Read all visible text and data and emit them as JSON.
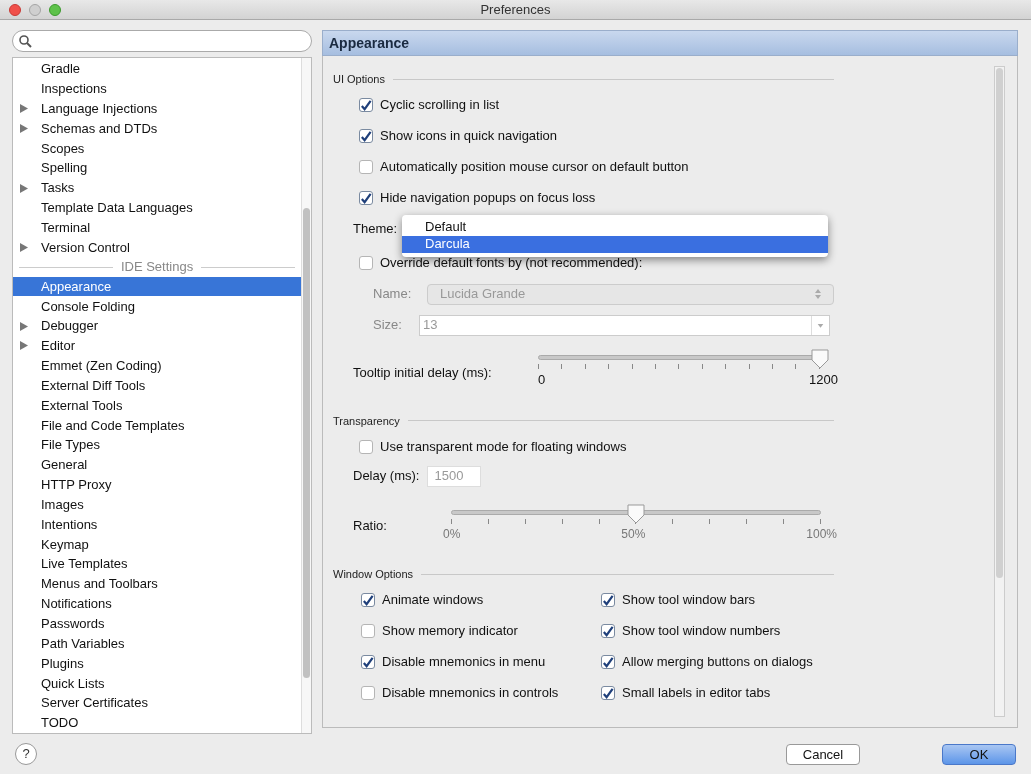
{
  "window": {
    "title": "Preferences"
  },
  "sidebar": {
    "items": [
      {
        "kind": "item",
        "label": "Gradle",
        "expandable": false,
        "selected": false
      },
      {
        "kind": "item",
        "label": "Inspections",
        "expandable": false,
        "selected": false
      },
      {
        "kind": "item",
        "label": "Language Injections",
        "expandable": true,
        "selected": false
      },
      {
        "kind": "item",
        "label": "Schemas and DTDs",
        "expandable": true,
        "selected": false
      },
      {
        "kind": "item",
        "label": "Scopes",
        "expandable": false,
        "selected": false
      },
      {
        "kind": "item",
        "label": "Spelling",
        "expandable": false,
        "selected": false
      },
      {
        "kind": "item",
        "label": "Tasks",
        "expandable": true,
        "selected": false
      },
      {
        "kind": "item",
        "label": "Template Data Languages",
        "expandable": false,
        "selected": false
      },
      {
        "kind": "item",
        "label": "Terminal",
        "expandable": false,
        "selected": false
      },
      {
        "kind": "item",
        "label": "Version Control",
        "expandable": true,
        "selected": false
      },
      {
        "kind": "header",
        "label": "IDE Settings"
      },
      {
        "kind": "item",
        "label": "Appearance",
        "expandable": false,
        "selected": true
      },
      {
        "kind": "item",
        "label": "Console Folding",
        "expandable": false,
        "selected": false
      },
      {
        "kind": "item",
        "label": "Debugger",
        "expandable": true,
        "selected": false
      },
      {
        "kind": "item",
        "label": "Editor",
        "expandable": true,
        "selected": false
      },
      {
        "kind": "item",
        "label": "Emmet (Zen Coding)",
        "expandable": false,
        "selected": false
      },
      {
        "kind": "item",
        "label": "External Diff Tools",
        "expandable": false,
        "selected": false
      },
      {
        "kind": "item",
        "label": "External Tools",
        "expandable": false,
        "selected": false
      },
      {
        "kind": "item",
        "label": "File and Code Templates",
        "expandable": false,
        "selected": false
      },
      {
        "kind": "item",
        "label": "File Types",
        "expandable": false,
        "selected": false
      },
      {
        "kind": "item",
        "label": "General",
        "expandable": false,
        "selected": false
      },
      {
        "kind": "item",
        "label": "HTTP Proxy",
        "expandable": false,
        "selected": false
      },
      {
        "kind": "item",
        "label": "Images",
        "expandable": false,
        "selected": false
      },
      {
        "kind": "item",
        "label": "Intentions",
        "expandable": false,
        "selected": false
      },
      {
        "kind": "item",
        "label": "Keymap",
        "expandable": false,
        "selected": false
      },
      {
        "kind": "item",
        "label": "Live Templates",
        "expandable": false,
        "selected": false
      },
      {
        "kind": "item",
        "label": "Menus and Toolbars",
        "expandable": false,
        "selected": false
      },
      {
        "kind": "item",
        "label": "Notifications",
        "expandable": false,
        "selected": false
      },
      {
        "kind": "item",
        "label": "Passwords",
        "expandable": false,
        "selected": false
      },
      {
        "kind": "item",
        "label": "Path Variables",
        "expandable": false,
        "selected": false
      },
      {
        "kind": "item",
        "label": "Plugins",
        "expandable": false,
        "selected": false
      },
      {
        "kind": "item",
        "label": "Quick Lists",
        "expandable": false,
        "selected": false
      },
      {
        "kind": "item",
        "label": "Server Certificates",
        "expandable": false,
        "selected": false
      },
      {
        "kind": "item",
        "label": "TODO",
        "expandable": false,
        "selected": false
      }
    ]
  },
  "panel": {
    "title": "Appearance",
    "ui_options": {
      "heading": "UI Options",
      "checkboxes": [
        {
          "label": "Cyclic scrolling in list",
          "checked": true
        },
        {
          "label": "Show icons in quick navigation",
          "checked": true
        },
        {
          "label": "Automatically position mouse cursor on default button",
          "checked": false
        },
        {
          "label": "Hide navigation popups on focus loss",
          "checked": true
        }
      ],
      "theme": {
        "label": "Theme:",
        "options": [
          {
            "label": "Default",
            "selected": false
          },
          {
            "label": "Darcula",
            "selected": true
          }
        ]
      },
      "override_fonts": {
        "label": "Override default fonts by (not recommended):",
        "checked": false
      },
      "font_name": {
        "label": "Name:",
        "value": "Lucida Grande",
        "disabled": true
      },
      "font_size": {
        "label": "Size:",
        "value": "13",
        "disabled": true
      },
      "tooltip_delay": {
        "label": "Tooltip initial delay (ms):",
        "level": 1,
        "min_label": "0",
        "max_label": "1200"
      }
    },
    "transparency": {
      "heading": "Transparency",
      "checkbox": {
        "label": "Use transparent mode for floating windows",
        "checked": false
      },
      "delay": {
        "label": "Delay (ms):",
        "value": "1500",
        "disabled": true
      },
      "ratio": {
        "label": "Ratio:",
        "level": 0.5,
        "labels": [
          "0%",
          "50%",
          "100%"
        ]
      }
    },
    "window_options": {
      "heading": "Window Options",
      "checkboxes": [
        {
          "label": "Animate windows",
          "checked": true
        },
        {
          "label": "Show tool window bars",
          "checked": true
        },
        {
          "label": "Show memory indicator",
          "checked": false
        },
        {
          "label": "Show tool window numbers",
          "checked": true
        },
        {
          "label": "Disable mnemonics in menu",
          "checked": true
        },
        {
          "label": "Allow merging buttons on dialogs",
          "checked": true
        },
        {
          "label": "Disable mnemonics in controls",
          "checked": false
        },
        {
          "label": "Small labels in editor tabs",
          "checked": true
        }
      ]
    }
  },
  "buttons": {
    "help": "?",
    "cancel": "Cancel",
    "ok": "OK"
  }
}
